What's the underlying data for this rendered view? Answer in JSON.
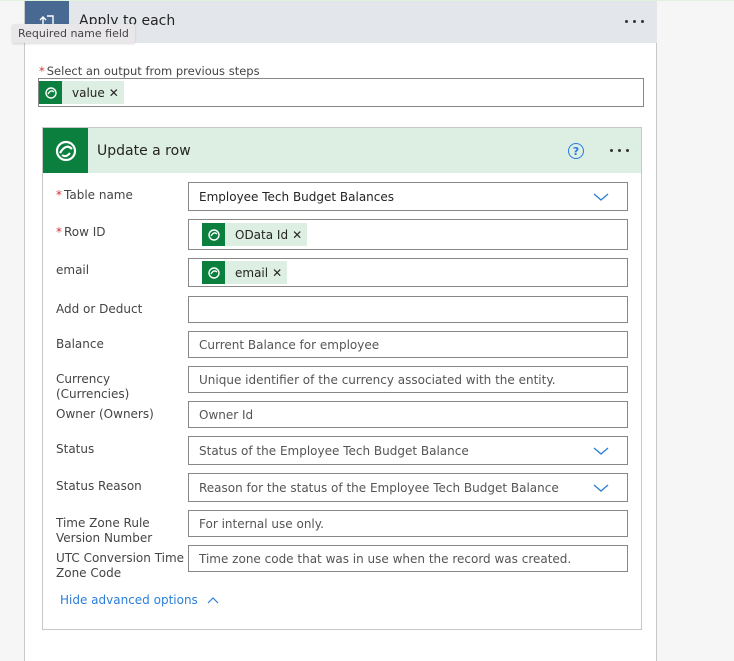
{
  "scope": {
    "title": "Apply to each",
    "tooltip": "Required name field",
    "select_label": "Select an output from previous steps",
    "select_token": "value"
  },
  "action": {
    "title": "Update a row",
    "help_glyph": "?",
    "fields": [
      {
        "label": "Table name",
        "required": true,
        "value": "Employee Tech Budget Balances",
        "type": "dropdown"
      },
      {
        "label": "Row ID",
        "required": true,
        "token": "OData Id",
        "type": "token"
      },
      {
        "label": "email",
        "required": false,
        "token": "email",
        "type": "token"
      },
      {
        "label": "Add or Deduct",
        "required": false,
        "placeholder": "",
        "type": "text"
      },
      {
        "label": "Balance",
        "required": false,
        "placeholder": "Current Balance for employee",
        "type": "text"
      },
      {
        "label": "Currency (Currencies)",
        "required": false,
        "placeholder": "Unique identifier of the currency associated with the entity.",
        "type": "text"
      },
      {
        "label": "Owner (Owners)",
        "required": false,
        "placeholder": "Owner Id",
        "type": "text"
      },
      {
        "label": "Status",
        "required": false,
        "placeholder": "Status of the Employee Tech Budget Balance",
        "type": "dropdown"
      },
      {
        "label": "Status Reason",
        "required": false,
        "placeholder": "Reason for the status of the Employee Tech Budget Balance",
        "type": "dropdown"
      },
      {
        "label": "Time Zone Rule Version Number",
        "required": false,
        "placeholder": "For internal use only.",
        "type": "text"
      },
      {
        "label": "UTC Conversion Time Zone Code",
        "required": false,
        "placeholder": "Time zone code that was in use when the record was created.",
        "type": "text"
      }
    ],
    "hide_advanced": "Hide advanced options"
  },
  "colors": {
    "scope_accent": "#486991",
    "dataverse_green": "#0b7f3d",
    "token_bg": "#ddeee3",
    "link_blue": "#2b7fd8",
    "required_red": "#d13438"
  }
}
